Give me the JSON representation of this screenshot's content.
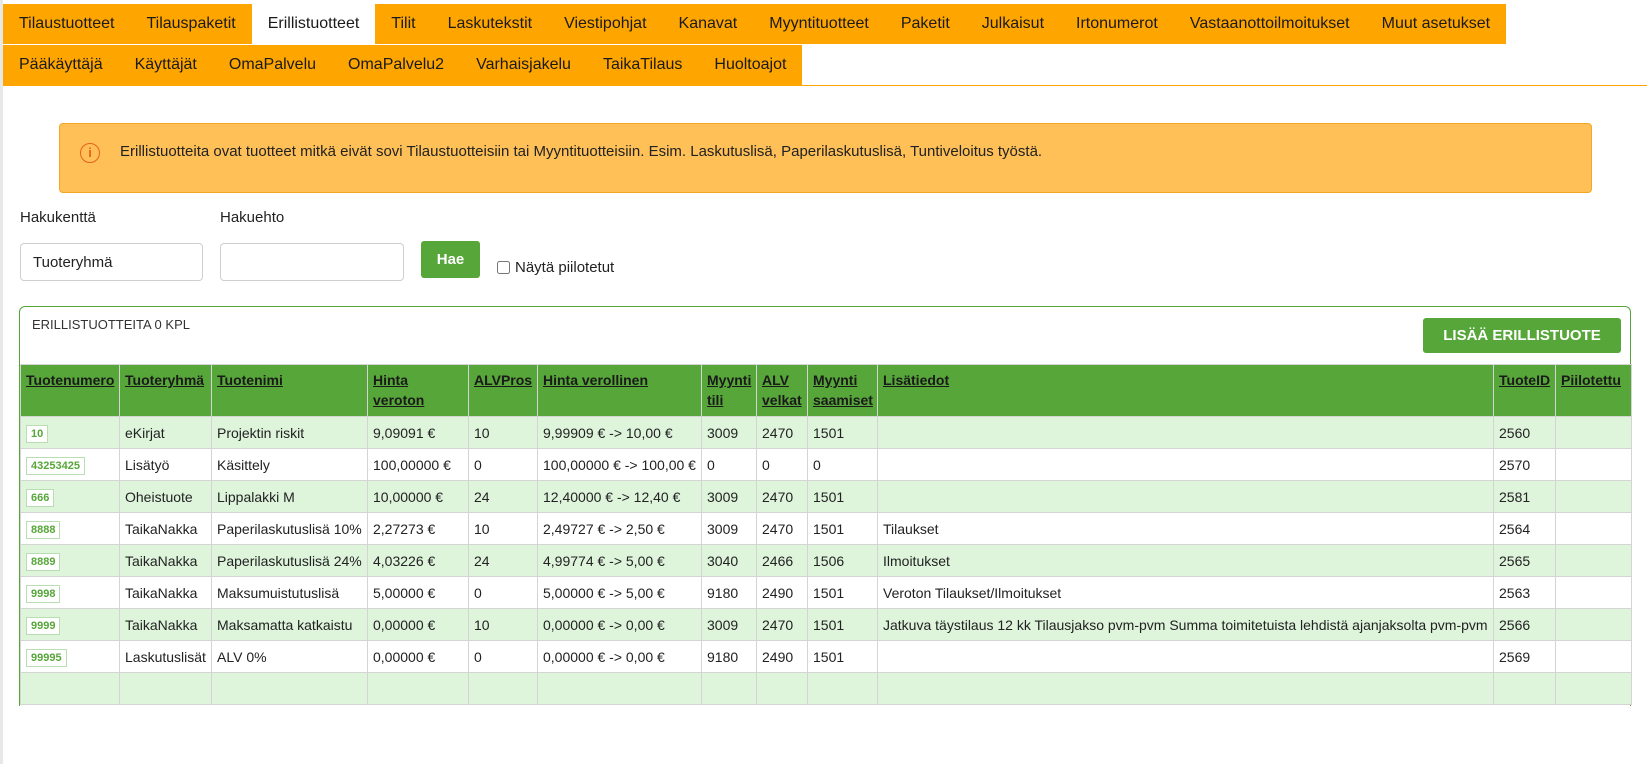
{
  "nav": {
    "row1": [
      "Tilaustuotteet",
      "Tilauspaketit",
      "Erillistuotteet",
      "Tilit",
      "Laskutekstit",
      "Viestipohjat",
      "Kanavat",
      "Myyntituotteet",
      "Paketit",
      "Julkaisut",
      "Irtonumerot",
      "Vastaanottoilmoitukset",
      "Muut asetukset"
    ],
    "row2": [
      "Pääkäyttäjä",
      "Käyttäjät",
      "OmaPalvelu",
      "OmaPalvelu2",
      "Varhaisjakelu",
      "TaikaTilaus",
      "Huoltoajot"
    ],
    "active": "Erillistuotteet"
  },
  "alert": {
    "icon": "info-icon",
    "text": "Erillistuotteita ovat tuotteet mitkä eivät sovi Tilaustuotteisiin tai Myyntituotteisiin. Esim. Laskutuslisä, Paperilaskutuslisä, Tuntiveloitus työstä."
  },
  "search": {
    "field_label": "Hakukenttä",
    "field_value": "Tuoteryhmä",
    "condition_label": "Hakuehto",
    "condition_value": "",
    "button": "Hae",
    "show_hidden_label": "Näytä piilotetut",
    "show_hidden_checked": false
  },
  "panel": {
    "title": "ERILLISTUOTTEITA 0 KPL",
    "add_button": "LISÄÄ ERILLISTUOTE"
  },
  "table": {
    "headers": [
      "Tuotenumero",
      "Tuoteryhmä",
      "Tuotenimi",
      "Hinta veroton",
      "ALVPros",
      "Hinta verollinen",
      "Myynti tili",
      "ALV velkat",
      "Myynti saamiset",
      "Lisätiedot",
      "TuoteID",
      "Piilotettu"
    ],
    "rows": [
      [
        "10",
        "eKirjat",
        "Projektin riskit",
        "9,09091 €",
        "10",
        "9,99909 € -> 10,00 €",
        "3009",
        "2470",
        "1501",
        "",
        "2560",
        ""
      ],
      [
        "43253425",
        "Lisätyö",
        "Käsittely",
        "100,00000 €",
        "0",
        "100,00000 € -> 100,00 €",
        "0",
        "0",
        "0",
        "",
        "2570",
        ""
      ],
      [
        "666",
        "Oheistuote",
        "Lippalakki M",
        "10,00000 €",
        "24",
        "12,40000 € -> 12,40 €",
        "3009",
        "2470",
        "1501",
        "",
        "2581",
        ""
      ],
      [
        "8888",
        "TaikaNakka",
        "Paperilaskutuslisä 10%",
        "2,27273 €",
        "10",
        "2,49727 € -> 2,50 €",
        "3009",
        "2470",
        "1501",
        "Tilaukset",
        "2564",
        ""
      ],
      [
        "8889",
        "TaikaNakka",
        "Paperilaskutuslisä 24%",
        "4,03226 €",
        "24",
        "4,99774 € -> 5,00 €",
        "3040",
        "2466",
        "1506",
        "Ilmoitukset",
        "2565",
        ""
      ],
      [
        "9998",
        "TaikaNakka",
        "Maksumuistutuslisä",
        "5,00000 €",
        "0",
        "5,00000 € -> 5,00 €",
        "9180",
        "2490",
        "1501",
        "Veroton Tilaukset/Ilmoitukset",
        "2563",
        ""
      ],
      [
        "9999",
        "TaikaNakka",
        "Maksamatta katkaistu",
        "0,00000 €",
        "10",
        "0,00000 € -> 0,00 €",
        "3009",
        "2470",
        "1501",
        "Jatkuva täystilaus 12 kk Tilausjakso pvm-pvm Summa toimitetuista lehdistä ajanjaksolta pvm-pvm",
        "2566",
        ""
      ],
      [
        "99995",
        "Laskutuslisät",
        "ALV 0%",
        "0,00000 €",
        "0",
        "0,00000 € -> 0,00 €",
        "9180",
        "2490",
        "1501",
        "",
        "2569",
        ""
      ]
    ]
  }
}
